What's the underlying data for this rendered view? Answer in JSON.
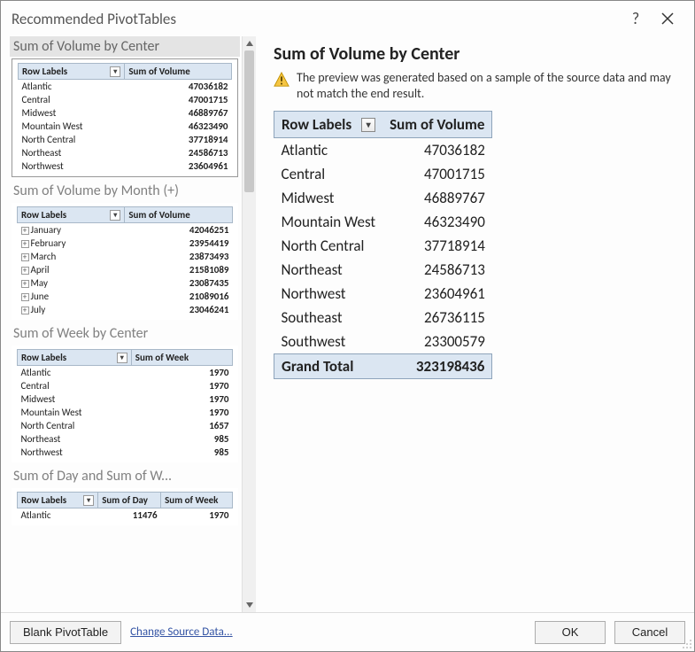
{
  "titlebar": {
    "title": "Recommended PivotTables"
  },
  "recommendations": [
    {
      "title": "Sum of Volume by Center",
      "selected": true,
      "headers": [
        "Row Labels",
        "Sum of Volume"
      ],
      "rows": [
        {
          "label": "Atlantic",
          "values": [
            "47036182"
          ]
        },
        {
          "label": "Central",
          "values": [
            "47001715"
          ]
        },
        {
          "label": "Midwest",
          "values": [
            "46889767"
          ]
        },
        {
          "label": "Mountain West",
          "values": [
            "46323490"
          ]
        },
        {
          "label": "North Central",
          "values": [
            "37718914"
          ]
        },
        {
          "label": "Northeast",
          "values": [
            "24586713"
          ]
        },
        {
          "label": "Northwest",
          "values": [
            "23604961"
          ]
        }
      ]
    },
    {
      "title": "Sum of Volume by Month (+)",
      "headers": [
        "Row Labels",
        "Sum of Volume"
      ],
      "expandable": true,
      "rows": [
        {
          "label": "January",
          "values": [
            "42046251"
          ]
        },
        {
          "label": "February",
          "values": [
            "23954419"
          ]
        },
        {
          "label": "March",
          "values": [
            "23873493"
          ]
        },
        {
          "label": "April",
          "values": [
            "21581089"
          ]
        },
        {
          "label": "May",
          "values": [
            "23087435"
          ]
        },
        {
          "label": "June",
          "values": [
            "21089016"
          ]
        },
        {
          "label": "July",
          "values": [
            "23046241"
          ]
        }
      ]
    },
    {
      "title": "Sum of Week by Center",
      "headers": [
        "Row Labels",
        "Sum of Week"
      ],
      "rows": [
        {
          "label": "Atlantic",
          "values": [
            "1970"
          ]
        },
        {
          "label": "Central",
          "values": [
            "1970"
          ]
        },
        {
          "label": "Midwest",
          "values": [
            "1970"
          ]
        },
        {
          "label": "Mountain West",
          "values": [
            "1970"
          ]
        },
        {
          "label": "North Central",
          "values": [
            "1657"
          ]
        },
        {
          "label": "Northeast",
          "values": [
            "985"
          ]
        },
        {
          "label": "Northwest",
          "values": [
            "985"
          ]
        }
      ]
    },
    {
      "title": "Sum of Day and Sum of W...",
      "headers": [
        "Row Labels",
        "Sum of Day",
        "Sum of Week"
      ],
      "rows": [
        {
          "label": "Atlantic",
          "values": [
            "11476",
            "1970"
          ]
        }
      ]
    }
  ],
  "preview": {
    "title": "Sum of Volume by Center",
    "warning": "The preview was generated based on a sample of the source data and may not match the end result.",
    "headers": [
      "Row Labels",
      "Sum of Volume"
    ],
    "rows": [
      {
        "label": "Atlantic",
        "value": "47036182"
      },
      {
        "label": "Central",
        "value": "47001715"
      },
      {
        "label": "Midwest",
        "value": "46889767"
      },
      {
        "label": "Mountain West",
        "value": "46323490"
      },
      {
        "label": "North Central",
        "value": "37718914"
      },
      {
        "label": "Northeast",
        "value": "24586713"
      },
      {
        "label": "Northwest",
        "value": "23604961"
      },
      {
        "label": "Southeast",
        "value": "26736115"
      },
      {
        "label": "Southwest",
        "value": "23300579"
      }
    ],
    "grand_total": {
      "label": "Grand Total",
      "value": "323198436"
    }
  },
  "footer": {
    "blank": "Blank PivotTable",
    "change_source": "Change Source Data...",
    "ok": "OK",
    "cancel": "Cancel"
  }
}
